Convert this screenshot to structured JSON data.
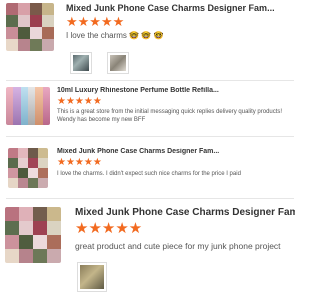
{
  "reviews": [
    {
      "title": "Mixed Junk Phone Case Charms Designer Fam...",
      "stars": "★★★★★",
      "text": "I love the charms 🤓 🤓 🤓",
      "photos": 2
    },
    {
      "title": "10ml Luxury Rhinestone Perfume Bottle Refilla...",
      "stars": "★★★★★",
      "text": "This is a great store from the initial messaging quick replies delivery quality products! Wendy has become my new BFF"
    },
    {
      "title": "Mixed Junk Phone Case Charms Designer Fam...",
      "stars": "★★★★★",
      "text": "I love the charms. I didn't expect such nice charms for the price I paid"
    },
    {
      "title": "Mixed Junk Phone Case Charms Designer Fam...",
      "stars": "★★★★★",
      "text": "great product and cute piece for my junk phone project",
      "photos": 1
    }
  ]
}
